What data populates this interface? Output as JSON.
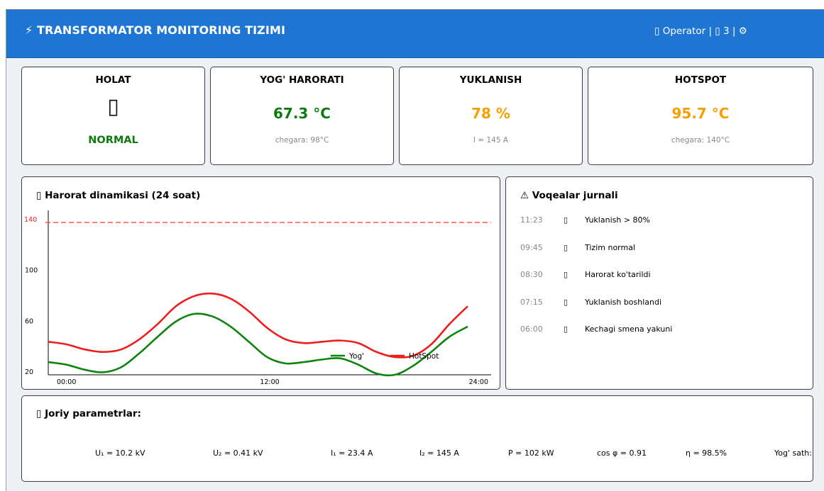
{
  "header": {
    "title": "⚡ TRANSFORMATOR MONITORING TIZIMI",
    "userbar": "▯ Operator | ▯ 3 | ⚙"
  },
  "kpis": {
    "holat": {
      "title": "HOLAT",
      "icon": "▯",
      "status": "NORMAL",
      "color": "#0d7a0d"
    },
    "oil": {
      "title": "YOG' HARORATI",
      "value": "67.3 °C",
      "sub": "chegara: 98°C",
      "color": "#0d7a0d"
    },
    "load": {
      "title": "YUKLANISH",
      "value": "78 %",
      "sub": "I = 145 A",
      "color": "#f5a000"
    },
    "hotspot": {
      "title": "HOTSPOT",
      "value": "95.7 °C",
      "sub": "chegara: 140°C",
      "color": "#f5a000"
    }
  },
  "chart": {
    "title": "▯ Harorat dinamikasi (24 soat)"
  },
  "chart_data": {
    "type": "line",
    "x": [
      0,
      1,
      2,
      3,
      4,
      5,
      6,
      7,
      8,
      9,
      10,
      11,
      12,
      13,
      14,
      15,
      16,
      17,
      18,
      19,
      20,
      21,
      22,
      23
    ],
    "series": [
      {
        "name": "Yog'",
        "color": "#0d840d",
        "values": [
          30,
          28,
          24,
          22,
          26,
          37,
          50,
          62,
          68,
          66,
          58,
          46,
          34,
          29,
          30,
          32,
          33,
          28,
          21,
          20,
          27,
          38,
          50,
          58
        ]
      },
      {
        "name": "HotSpot",
        "color": "#ee1c1c",
        "values": [
          46,
          44,
          40,
          38,
          40,
          48,
          60,
          74,
          82,
          84,
          80,
          70,
          57,
          48,
          45,
          46,
          47,
          45,
          38,
          34,
          35,
          44,
          60,
          74
        ]
      }
    ],
    "threshold": {
      "value": 140,
      "label": "140",
      "color": "#ff5555"
    },
    "yticks": [
      "20",
      "60",
      "100"
    ],
    "ytick_values": [
      20,
      60,
      100
    ],
    "xticks": [
      "00:00",
      "12:00",
      "24:00"
    ],
    "xtick_values": [
      0,
      12,
      24
    ],
    "ylim": [
      20,
      140
    ],
    "xlim": [
      0,
      24
    ],
    "legend_position": "lower-right"
  },
  "events": {
    "title": "⚠ Voqealar jurnali",
    "items": [
      {
        "time": "11:23",
        "icon": "▯",
        "msg": "Yuklanish > 80%"
      },
      {
        "time": "09:45",
        "icon": "▯",
        "msg": "Tizim normal"
      },
      {
        "time": "08:30",
        "icon": "▯",
        "msg": "Harorat ko'tarildi"
      },
      {
        "time": "07:15",
        "icon": "▯",
        "msg": "Yuklanish boshlandi"
      },
      {
        "time": "06:00",
        "icon": "▯",
        "msg": "Kechagi smena yakuni"
      }
    ]
  },
  "params": {
    "title": "▯ Joriy parametrlar:",
    "items": [
      "U₁ = 10.2 kV",
      "U₂ = 0.41 kV",
      "I₁ = 23.4 A",
      "I₂ = 145 A",
      "P = 102 kW",
      "cos φ = 0.91",
      "η = 98.5%",
      "Yog' sath: OK"
    ]
  }
}
